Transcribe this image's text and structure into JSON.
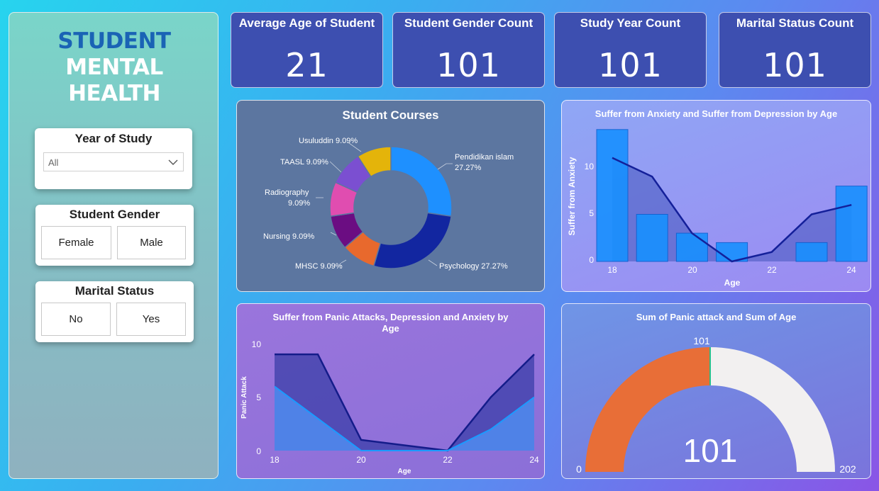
{
  "logo": {
    "word1": "STUDENT",
    "word2": "MENTAL",
    "word3": "HEALTH"
  },
  "slicers": {
    "year": {
      "title": "Year of Study",
      "value": "All"
    },
    "gender": {
      "title": "Student Gender",
      "options": [
        "Female",
        "Male"
      ]
    },
    "marital": {
      "title": "Marital Status",
      "options": [
        "No",
        "Yes"
      ]
    }
  },
  "kpis": [
    {
      "title": "Average Age of Student",
      "value": "21"
    },
    {
      "title": "Student Gender Count",
      "value": "101"
    },
    {
      "title": "Study Year Count",
      "value": "101"
    },
    {
      "title": "Marital Status Count",
      "value": "101"
    }
  ],
  "colors": {
    "kpi_bg": "#3d4fb0",
    "donut": [
      "#1e90ff",
      "#1226a0",
      "#e8692d",
      "#6b0d82",
      "#e04db0",
      "#7b4fd1",
      "#e4b40a"
    ],
    "gauge_fill": "#e86e37",
    "gauge_rest": "#f2f0f0"
  },
  "chart_data": [
    {
      "type": "pie",
      "title": "Student Courses",
      "categories": [
        "Pendidikan islam",
        "Psychology",
        "MHSC",
        "Nursing",
        "Radiography",
        "TAASL",
        "Usuluddin"
      ],
      "values": [
        27.27,
        27.27,
        9.09,
        9.09,
        9.09,
        9.09,
        9.09
      ],
      "labels": [
        "Pendidikan islam",
        "27.27%",
        "Psychology 27.27%",
        "MHSC 9.09%",
        "Nursing 9.09%",
        "Radiography",
        "9.09%",
        "TAASL 9.09%",
        "Usuluddin 9.09%"
      ]
    },
    {
      "type": "bar",
      "title": "Suffer from Anxiety and Suffer from Depression by Age",
      "x": [
        18,
        19,
        20,
        21,
        22,
        23,
        24
      ],
      "series": [
        {
          "type": "bar",
          "values": [
            14,
            5,
            3,
            2,
            0,
            2,
            8
          ]
        },
        {
          "type": "line",
          "values": [
            11,
            9,
            3,
            0,
            1,
            5,
            6
          ]
        }
      ],
      "xlabel": "Age",
      "ylabel": "Suffer from Anxiety",
      "xticks": [
        "18",
        "20",
        "22",
        "24"
      ],
      "yticks": [
        "0",
        "5",
        "10"
      ],
      "ylim": [
        0,
        14
      ]
    },
    {
      "type": "area",
      "title": "Suffer from Panic Attacks, Depression and Anxiety by Age",
      "x": [
        18,
        19,
        20,
        21,
        22,
        23,
        24
      ],
      "series": [
        {
          "values": [
            9,
            9,
            1,
            0.5,
            0,
            5,
            9
          ]
        },
        {
          "values": [
            6,
            3,
            0,
            0,
            0,
            2,
            5
          ]
        }
      ],
      "xlabel": "Age",
      "ylabel": "Panic Attack",
      "xticks": [
        "18",
        "20",
        "22",
        "24"
      ],
      "yticks": [
        "0",
        "5",
        "10"
      ],
      "ylim": [
        0,
        10
      ]
    },
    {
      "type": "gauge",
      "title": "Sum of Panic attack and Sum of Age",
      "value": 101,
      "min": 0,
      "max": 202,
      "target": 101,
      "labels": {
        "value": "101",
        "min": "0",
        "max": "202",
        "target": "101"
      }
    }
  ]
}
